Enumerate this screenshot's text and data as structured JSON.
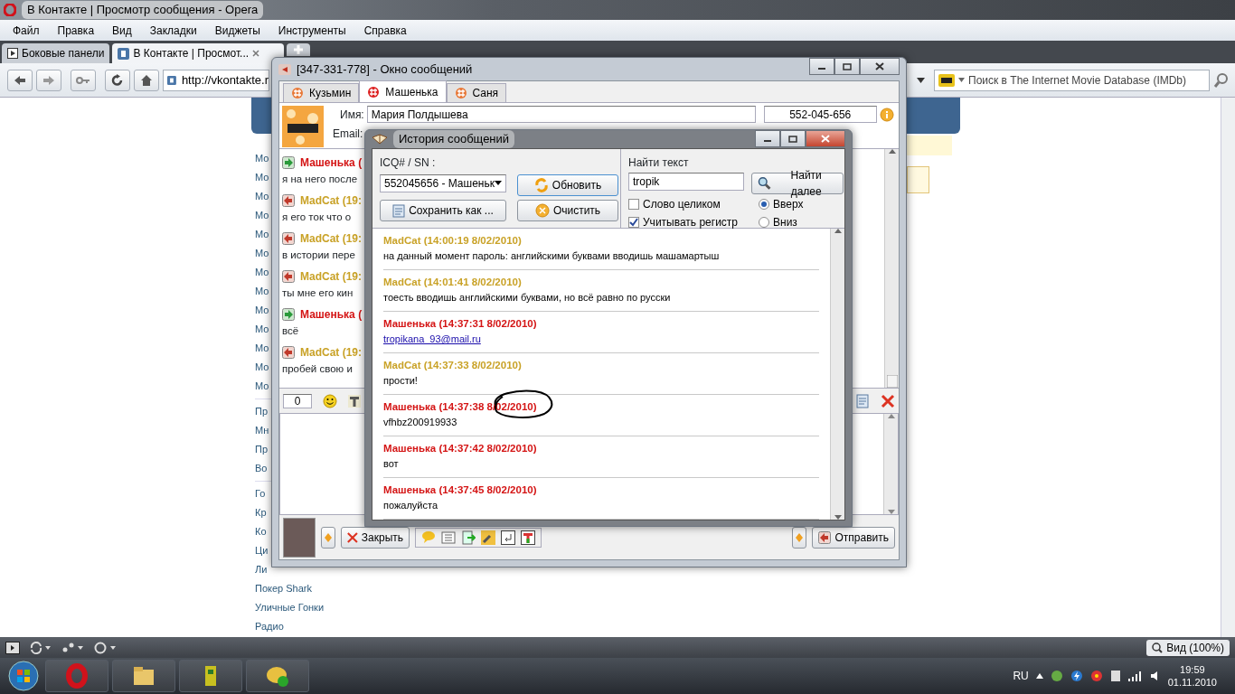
{
  "browser": {
    "title": "В Контакте | Просмотр сообщения - Opera",
    "menu": [
      "Файл",
      "Правка",
      "Вид",
      "Закладки",
      "Виджеты",
      "Инструменты",
      "Справка"
    ],
    "tabs": [
      {
        "label": "Боковые панели",
        "selected": false
      },
      {
        "label": "В Контакте | Просмот...",
        "selected": true
      }
    ],
    "address": "http://vkontakte.r",
    "search_placeholder": "Поиск в The Internet Movie Database (IMDb)",
    "zoom": "Вид (100%)"
  },
  "page": {
    "sidebar_groups": [
      [
        "Мо",
        "Мо",
        "Мо",
        "Мо",
        "Мо",
        "Мо",
        "Мо",
        "Мо",
        "Мо",
        "Мо",
        "Мо",
        "Мо",
        "Мо"
      ],
      [
        "Пр",
        "Мн",
        "Пр",
        "Во"
      ],
      [
        "Го",
        "Кр",
        "Ко",
        "Ци",
        "Ли",
        "Покер Shark",
        "Уличные Гонки",
        "Радио"
      ]
    ]
  },
  "chat_window": {
    "title": "[347-331-778] - Окно сообщений",
    "tabs": [
      {
        "label": "Кузьмин",
        "selected": false
      },
      {
        "label": "Машенька",
        "selected": true
      },
      {
        "label": "Саня",
        "selected": false
      }
    ],
    "contact": {
      "name_label": "Имя:",
      "name": "Мария  Полдышева",
      "uin": "552-045-656",
      "email_label": "Email:"
    },
    "messages": [
      {
        "kind": "incoming",
        "author": "Машенька (",
        "text": "я на него после"
      },
      {
        "kind": "outgoing",
        "author": "MadCat (19:",
        "text": "я его ток что о"
      },
      {
        "kind": "outgoing",
        "author": "MadCat (19:",
        "text": "в истории пере"
      },
      {
        "kind": "outgoing",
        "author": "MadCat (19:",
        "text": "ты мне его кин"
      },
      {
        "kind": "incoming",
        "author": "Машенька (",
        "text": "всё"
      },
      {
        "kind": "outgoing",
        "author": "MadCat (19:",
        "text": "пробей свою и"
      }
    ],
    "char_counter": "0",
    "close_button": "Закрыть",
    "send_button": "Отправить"
  },
  "history_window": {
    "title": "История сообщений",
    "contact_label": "ICQ# / SN :",
    "contact_value": "552045656 - Машеньк",
    "refresh_button": "Обновить",
    "save_button": "Сохранить как ...",
    "clear_button": "Очистить",
    "find_label": "Найти текст",
    "find_value": "tropik",
    "find_next_button": "Найти далее",
    "options": [
      {
        "label": "Слово целиком",
        "checked": false
      },
      {
        "label": "Учитывать регистр",
        "checked": true
      }
    ],
    "direction": [
      {
        "label": "Вверх",
        "selected": true
      },
      {
        "label": "Вниз",
        "selected": false
      }
    ],
    "entries": [
      {
        "kind": "outgoing",
        "header": "MadCat (14:00:19 8/02/2010)",
        "text": "на данный момент пароль: английскими буквами вводишь машамартыш",
        "link": false
      },
      {
        "kind": "outgoing",
        "header": "MadCat (14:01:41 8/02/2010)",
        "text": "тоесть вводишь английскими буквами, но всё равно по русски",
        "link": false
      },
      {
        "kind": "incoming",
        "header": "Машенька (14:37:31 8/02/2010)",
        "text": "tropikana_93@mail.ru",
        "link": true
      },
      {
        "kind": "outgoing",
        "header": "MadCat (14:37:33 8/02/2010)",
        "text": "прости!",
        "link": false
      },
      {
        "kind": "incoming",
        "header": "Машенька (14:37:38 8/02/2010)",
        "text": "vfhbz200919933",
        "link": false
      },
      {
        "kind": "incoming",
        "header": "Машенька (14:37:42 8/02/2010)",
        "text": "вот",
        "link": false
      },
      {
        "kind": "incoming",
        "header": "Машенька (14:37:45 8/02/2010)",
        "text": "пожалуйста",
        "link": false
      }
    ]
  },
  "taskbar": {
    "language": "RU",
    "time": "19:59",
    "date": "01.11.2010"
  }
}
